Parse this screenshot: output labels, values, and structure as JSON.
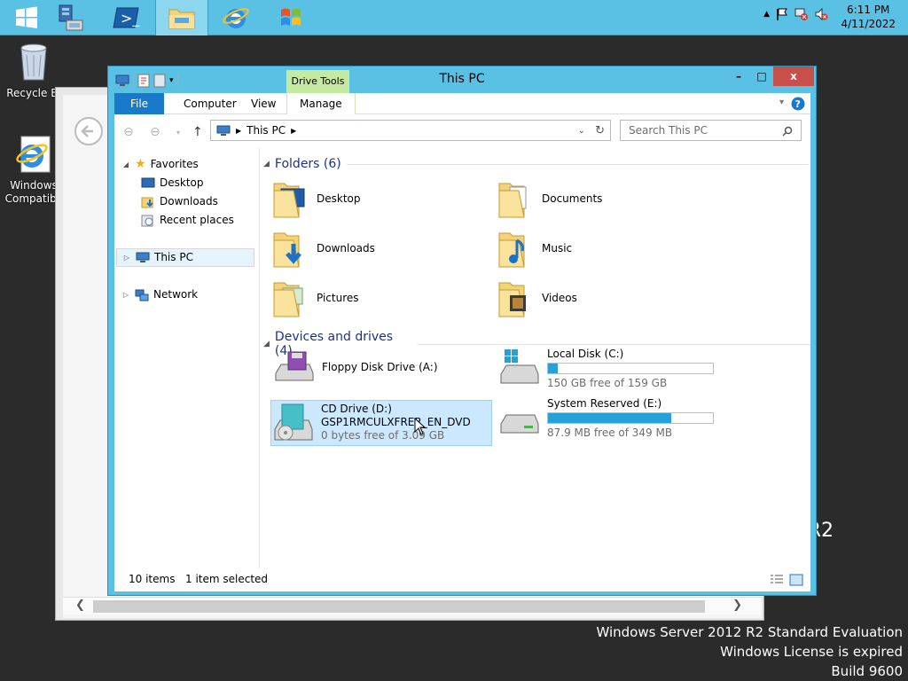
{
  "taskbar": {
    "apps": [
      "start-button",
      "server-manager",
      "powershell",
      "file-explorer",
      "internet-explorer",
      "windows-update"
    ],
    "clock_time": "6:11 PM",
    "clock_date": "4/11/2022"
  },
  "desktop": {
    "recycle_bin_label": "Recycle Bi",
    "ie_label_line1": "Windows",
    "ie_label_line2": "Compatibil"
  },
  "watermark": {
    "line1": "Windows Server 2012 R2 Standard Evaluation",
    "line2": "Windows License is expired",
    "line3": "Build 9600",
    "fragment": "R2"
  },
  "window": {
    "title": "This PC",
    "drive_tools_label": "Drive Tools",
    "controls": {
      "minimize": "–",
      "maximize": "□",
      "close": "x"
    }
  },
  "ribbon": {
    "tabs": [
      "File",
      "Computer",
      "View",
      "Manage"
    ]
  },
  "address": {
    "path": "This PC",
    "search_placeholder": "Search This PC"
  },
  "nav": {
    "favorites": "Favorites",
    "desktop": "Desktop",
    "downloads": "Downloads",
    "recent": "Recent places",
    "this_pc": "This PC",
    "network": "Network"
  },
  "folders": {
    "header": "Folders (6)",
    "items": [
      "Desktop",
      "Documents",
      "Downloads",
      "Music",
      "Pictures",
      "Videos"
    ]
  },
  "drives": {
    "header": "Devices and drives (4)",
    "floppy": {
      "name": "Floppy Disk Drive (A:)"
    },
    "local_c": {
      "name": "Local Disk (C:)",
      "free": "150 GB free of 159 GB",
      "used_fraction": 0.057
    },
    "cd_d": {
      "name": "CD Drive (D:)",
      "label": "GSP1RMCULXFRER_EN_DVD",
      "free": "0 bytes free of 3.09 GB"
    },
    "reserved_e": {
      "name": "System Reserved (E:)",
      "free": "87.9 MB free of 349 MB",
      "used_fraction": 0.748
    }
  },
  "status": {
    "items": "10 items",
    "selected": "1 item selected"
  },
  "colors": {
    "accent": "#5bc1e4",
    "file_tab": "#1979ca",
    "drive_bar": "#26a0da",
    "close": "#c7504a"
  }
}
